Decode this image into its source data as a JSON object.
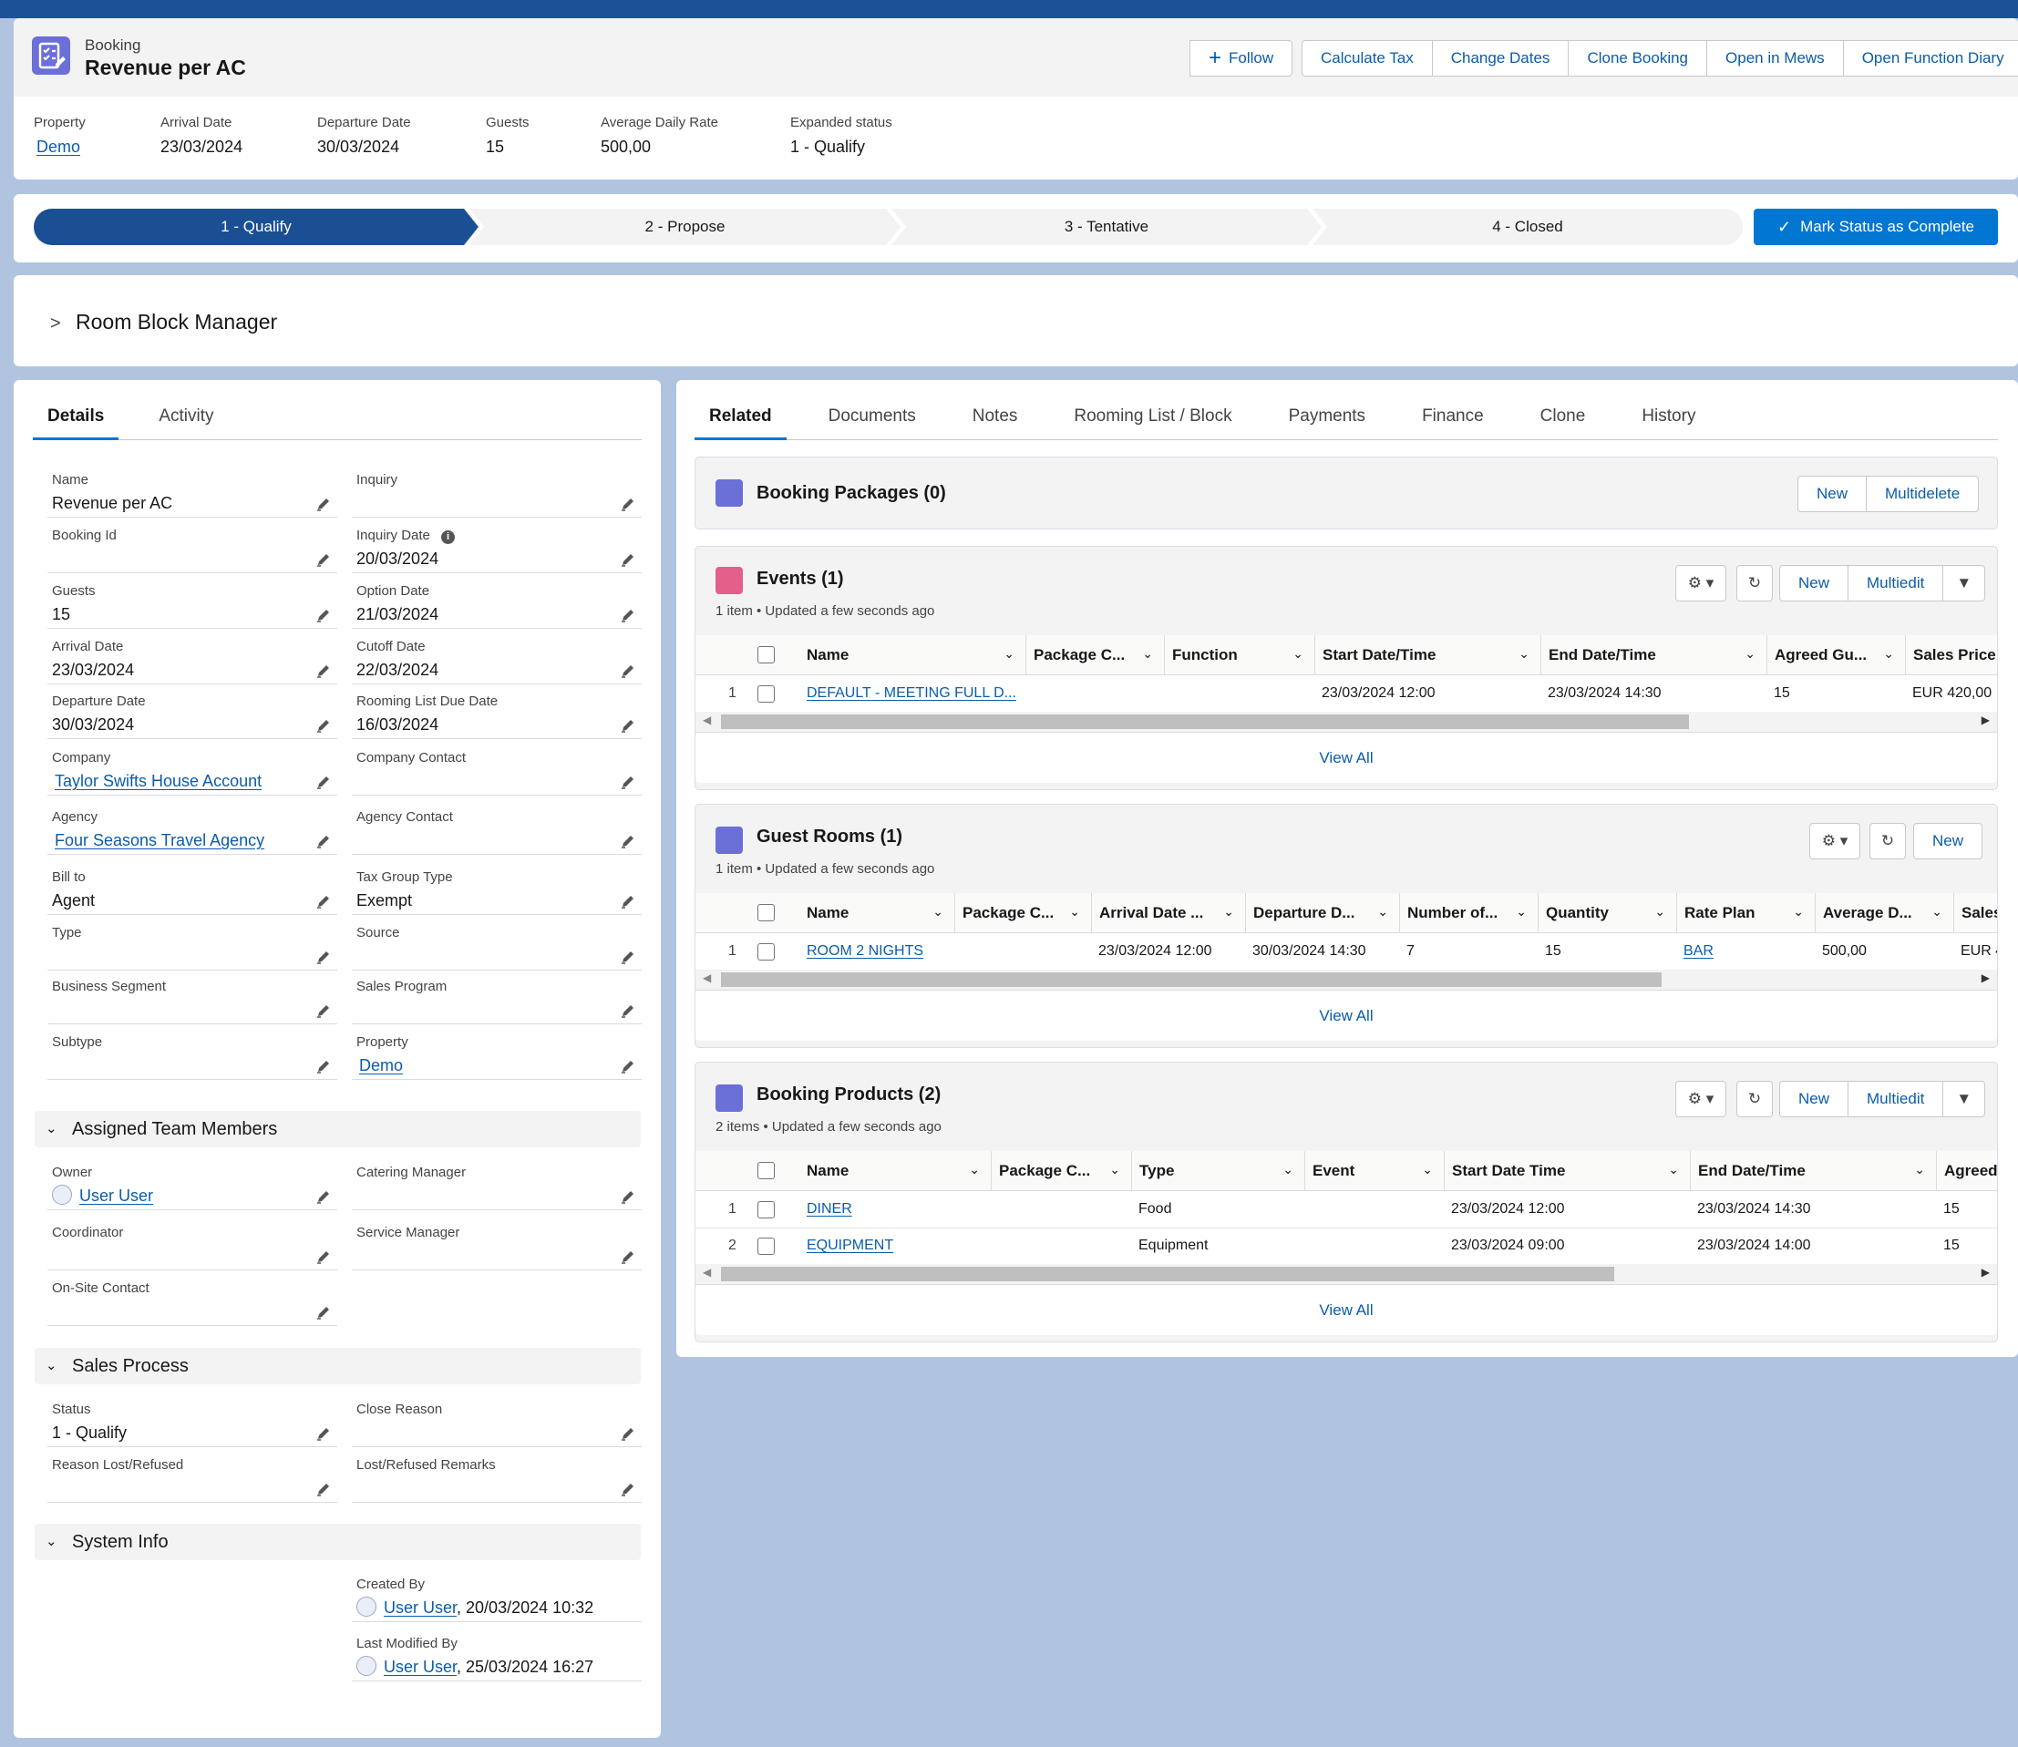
{
  "record": {
    "object_label": "Booking",
    "title": "Revenue per AC"
  },
  "header_actions": {
    "follow": "Follow",
    "calculate_tax": "Calculate Tax",
    "change_dates": "Change Dates",
    "clone_booking": "Clone Booking",
    "open_in_mews": "Open in Mews",
    "open_function_diary": "Open Function Diary"
  },
  "highlights": [
    {
      "label": "Property",
      "value": "Demo",
      "link": true
    },
    {
      "label": "Arrival Date",
      "value": "23/03/2024"
    },
    {
      "label": "Departure Date",
      "value": "30/03/2024"
    },
    {
      "label": "Guests",
      "value": "15"
    },
    {
      "label": "Average Daily Rate",
      "value": "500,00"
    },
    {
      "label": "Expanded status",
      "value": "1 - Qualify"
    }
  ],
  "path": {
    "steps": [
      "1 - Qualify",
      "2 - Propose",
      "3 - Tentative",
      "4 - Closed"
    ],
    "active_index": 0,
    "mark_complete": "Mark Status as Complete"
  },
  "room_block": {
    "title": "Room Block Manager"
  },
  "left_tabs": [
    "Details",
    "Activity"
  ],
  "details": {
    "fields_left": [
      {
        "label": "Name",
        "value": "Revenue per AC"
      },
      {
        "label": "Booking Id",
        "value": ""
      },
      {
        "label": "Guests",
        "value": "15"
      },
      {
        "label": "Arrival Date",
        "value": "23/03/2024"
      },
      {
        "label": "Departure Date",
        "value": "30/03/2024"
      },
      {
        "label": "Company",
        "value": "Taylor Swifts House Account",
        "link": true
      },
      {
        "label": "Agency",
        "value": "Four Seasons Travel Agency",
        "link": true
      },
      {
        "label": "Bill to",
        "value": "Agent"
      },
      {
        "label": "Type",
        "value": ""
      },
      {
        "label": "Business Segment",
        "value": ""
      },
      {
        "label": "Subtype",
        "value": ""
      }
    ],
    "fields_right": [
      {
        "label": "Inquiry",
        "value": ""
      },
      {
        "label": "Inquiry Date",
        "value": "20/03/2024",
        "info": true
      },
      {
        "label": "Option Date",
        "value": "21/03/2024"
      },
      {
        "label": "Cutoff Date",
        "value": "22/03/2024"
      },
      {
        "label": "Rooming List Due Date",
        "value": "16/03/2024"
      },
      {
        "label": "Company Contact",
        "value": ""
      },
      {
        "label": "Agency Contact",
        "value": ""
      },
      {
        "label": "Tax Group Type",
        "value": "Exempt"
      },
      {
        "label": "Source",
        "value": ""
      },
      {
        "label": "Sales Program",
        "value": ""
      },
      {
        "label": "Property",
        "value": "Demo",
        "link": true
      }
    ],
    "team_section": "Assigned Team Members",
    "team_left": [
      {
        "label": "Owner",
        "value": "User User",
        "link": true,
        "avatar": true
      },
      {
        "label": "Coordinator",
        "value": ""
      },
      {
        "label": "On-Site Contact",
        "value": ""
      }
    ],
    "team_right": [
      {
        "label": "Catering Manager",
        "value": ""
      },
      {
        "label": "Service Manager",
        "value": ""
      }
    ],
    "sales_section": "Sales Process",
    "sales_left": [
      {
        "label": "Status",
        "value": "1 - Qualify"
      },
      {
        "label": "Reason Lost/Refused",
        "value": ""
      }
    ],
    "sales_right": [
      {
        "label": "Close Reason",
        "value": ""
      },
      {
        "label": "Lost/Refused Remarks",
        "value": ""
      }
    ],
    "system_section": "System Info",
    "system_right": [
      {
        "label": "Created By",
        "user": "User User",
        "date": "20/03/2024 10:32"
      },
      {
        "label": "Last Modified By",
        "user": "User User",
        "date": "25/03/2024 16:27"
      }
    ]
  },
  "right_tabs": [
    "Related",
    "Documents",
    "Notes",
    "Rooming List / Block",
    "Payments",
    "Finance",
    "Clone",
    "History"
  ],
  "related": {
    "booking_packages": {
      "title": "Booking Packages (0)",
      "new": "New",
      "multidelete": "Multidelete"
    },
    "events": {
      "title": "Events (1)",
      "subtitle": "1 item • Updated a few seconds ago",
      "new": "New",
      "multiedit": "Multiedit",
      "view_all": "View All",
      "columns": [
        "Name",
        "Package C...",
        "Function",
        "Start Date/Time",
        "End Date/Time",
        "Agreed Gu...",
        "Sales Price inc"
      ],
      "rows": [
        {
          "num": "1",
          "cells": [
            "DEFAULT - MEETING FULL D...",
            "",
            "",
            "23/03/2024 12:00",
            "23/03/2024 14:30",
            "15",
            "EUR 420,00"
          ]
        }
      ]
    },
    "guest_rooms": {
      "title": "Guest Rooms (1)",
      "subtitle": "1 item • Updated a few seconds ago",
      "new": "New",
      "view_all": "View All",
      "columns": [
        "Name",
        "Package C...",
        "Arrival Date ...",
        "Departure D...",
        "Number of...",
        "Quantity",
        "Rate Plan",
        "Average D...",
        "Sales"
      ],
      "rows": [
        {
          "num": "1",
          "cells": [
            "ROOM 2 NIGHTS",
            "",
            "23/03/2024 12:00",
            "30/03/2024 14:30",
            "7",
            "15",
            "BAR",
            "500,00",
            "EUR 4"
          ]
        }
      ]
    },
    "booking_products": {
      "title": "Booking Products (2)",
      "subtitle": "2 items • Updated a few seconds ago",
      "new": "New",
      "multiedit": "Multiedit",
      "view_all": "View All",
      "columns": [
        "Name",
        "Package C...",
        "Type",
        "Event",
        "Start Date Time",
        "End Date/Time",
        "Agreed"
      ],
      "rows": [
        {
          "num": "1",
          "cells": [
            "DINER",
            "",
            "Food",
            "",
            "23/03/2024 12:00",
            "23/03/2024 14:30",
            "15"
          ]
        },
        {
          "num": "2",
          "cells": [
            "EQUIPMENT",
            "",
            "Equipment",
            "",
            "23/03/2024 09:00",
            "23/03/2024 14:00",
            "15"
          ]
        }
      ]
    }
  },
  "colors": {
    "brand": "#0176d3",
    "path_active": "#1b4f93",
    "background": "#b0c4df",
    "link": "#0b5cab"
  }
}
